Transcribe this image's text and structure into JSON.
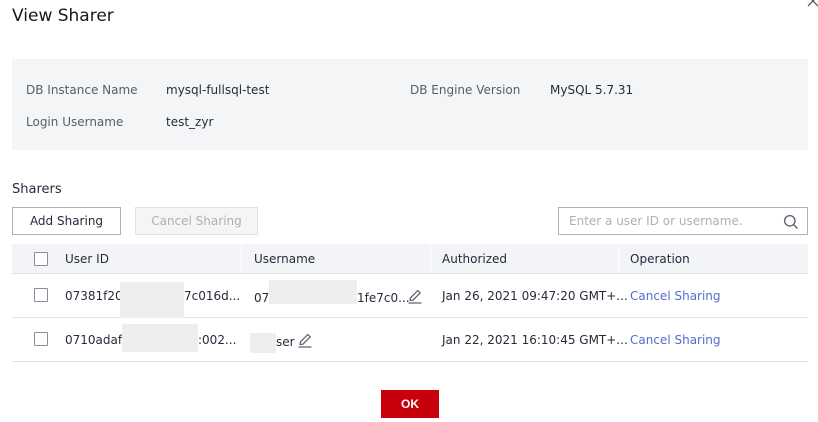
{
  "dialog": {
    "title": "View Sharer",
    "ok_label": "OK"
  },
  "info": {
    "db_instance_name_label": "DB Instance Name",
    "db_instance_name_value": "mysql-fullsql-test",
    "db_engine_version_label": "DB Engine Version",
    "db_engine_version_value": "MySQL 5.7.31",
    "login_username_label": "Login Username",
    "login_username_value": "test_zyr"
  },
  "sharers": {
    "section_title": "Sharers",
    "add_sharing_label": "Add Sharing",
    "cancel_sharing_label": "Cancel Sharing",
    "search_placeholder": "Enter a user ID or username.",
    "columns": [
      "User ID",
      "Username",
      "Authorized",
      "Operation"
    ],
    "rows": [
      {
        "user_id_start": "07381f20c",
        "user_id_end": "7c016d...",
        "username_start": "07",
        "username_end": "1fe7c0...",
        "authorized": "Jan 26, 2021 09:47:20 GMT+...",
        "operation": "Cancel Sharing"
      },
      {
        "user_id_start": "0710adaf",
        "user_id_end": ":002...",
        "username_start": "",
        "username_end": "ser",
        "authorized": "Jan 22, 2021 16:10:45 GMT+...",
        "operation": "Cancel Sharing"
      }
    ]
  },
  "icons": {
    "close": "close-icon",
    "search": "search-icon",
    "edit": "edit-icon"
  },
  "colors": {
    "primary_button": "#c7000b",
    "link": "#526ecc",
    "panel_bg": "#f4f5f6",
    "table_header_bg": "#f3f4f8"
  }
}
